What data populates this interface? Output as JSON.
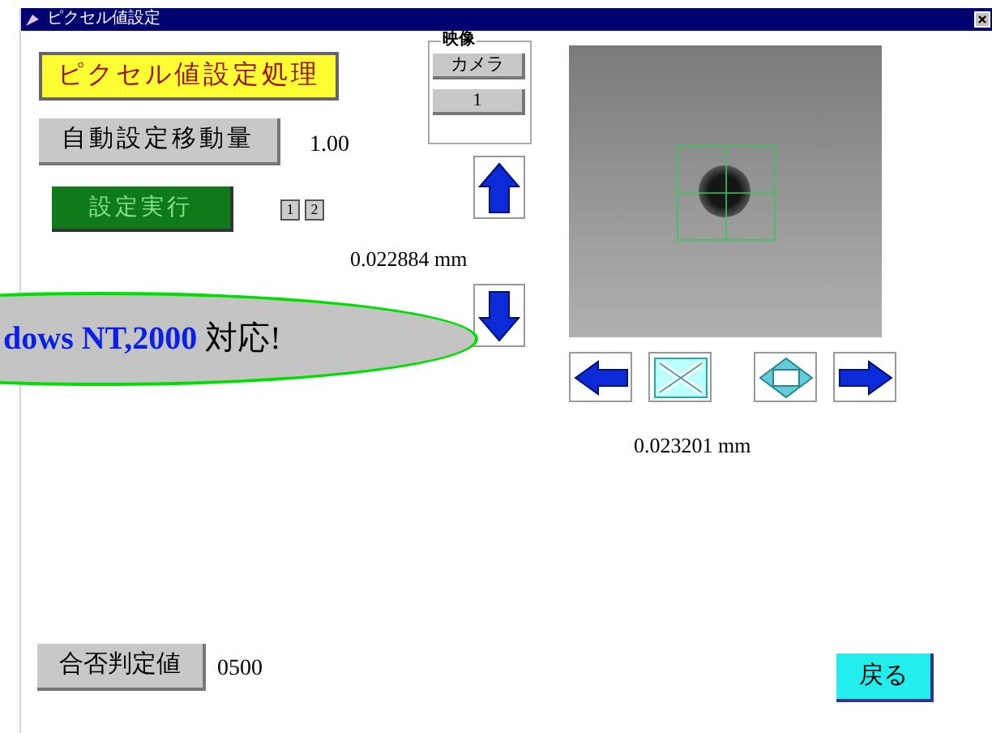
{
  "window": {
    "title": "ピクセル値設定"
  },
  "header_label": "ピクセル値設定処理",
  "auto_move": {
    "button": "自動設定移動量",
    "value": "1.00"
  },
  "run_button": "設定実行",
  "page_buttons": [
    "1",
    "2"
  ],
  "video_group": {
    "title": "映像",
    "buttons": [
      "カメラ",
      "1"
    ]
  },
  "vertical_reading": "0.022884 mm",
  "horizontal_reading": "0.023201 mm",
  "callout": "**dows NT,2000** 対応!",
  "judge": {
    "button": "合否判定値",
    "value": "0500"
  },
  "back_button": "戻る"
}
